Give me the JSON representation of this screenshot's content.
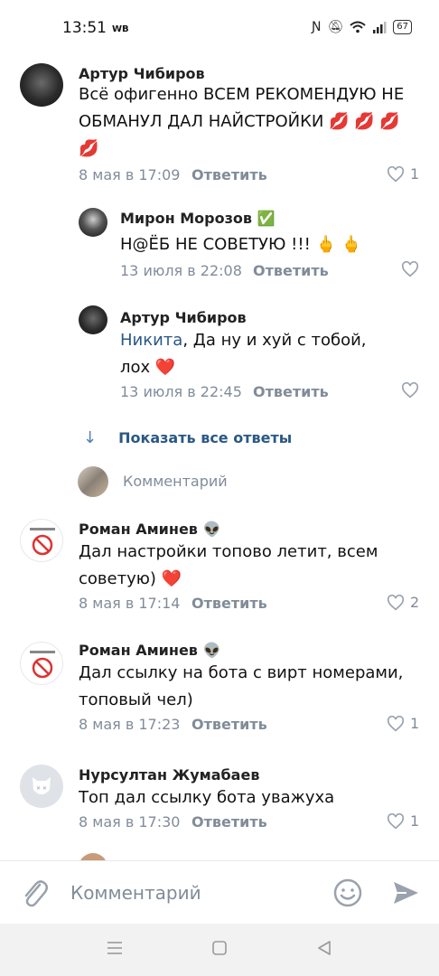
{
  "status_bar": {
    "time": "13:51",
    "carrier": "WB",
    "battery": "67"
  },
  "comments": [
    {
      "author": "Артур Чибиров",
      "text": "Всё офигенно ВСЕМ РЕКОМЕНДУЮ НЕ ОБМАНУЛ ДАЛ НАЙСТРОЙКИ 💋 💋 💋 💋",
      "date": "8 мая в 17:09",
      "reply": "Ответить",
      "likes": "1"
    },
    {
      "author": "Мирон Морозов ✅",
      "text": "Н@ЁБ НЕ СОВЕТУЮ !!! 🖕 🖕",
      "date": "13 июля в 22:08",
      "reply": "Ответить",
      "likes": ""
    },
    {
      "author": "Артур Чибиров",
      "mention": "Никита",
      "text": ", Да ну и хуй с тобой, лох ❤️",
      "date": "13 июля в 22:45",
      "reply": "Ответить",
      "likes": ""
    },
    {
      "author": "Роман Аминев 👽",
      "text": "Дал настройки топово летит, всем советую) ❤️",
      "date": "8 мая в 17:14",
      "reply": "Ответить",
      "likes": "2"
    },
    {
      "author": "Роман Аминев 👽",
      "text": "Дал ссылку на бота с вирт номерами, топовый чел)",
      "date": "8 мая в 17:23",
      "reply": "Ответить",
      "likes": "1"
    },
    {
      "author": "Нурсултан Жумабаев",
      "text": "Топ дал ссылку бота уважуха",
      "date": "8 мая в 17:30",
      "reply": "Ответить",
      "likes": "1"
    }
  ],
  "show_all_replies": "Показать все ответы",
  "inline_comment_placeholder": "Комментарий",
  "composer": {
    "placeholder": "Комментарий"
  },
  "colors": {
    "accent": "#2a5885",
    "meta": "#818c99",
    "icon": "#99a2ad"
  }
}
